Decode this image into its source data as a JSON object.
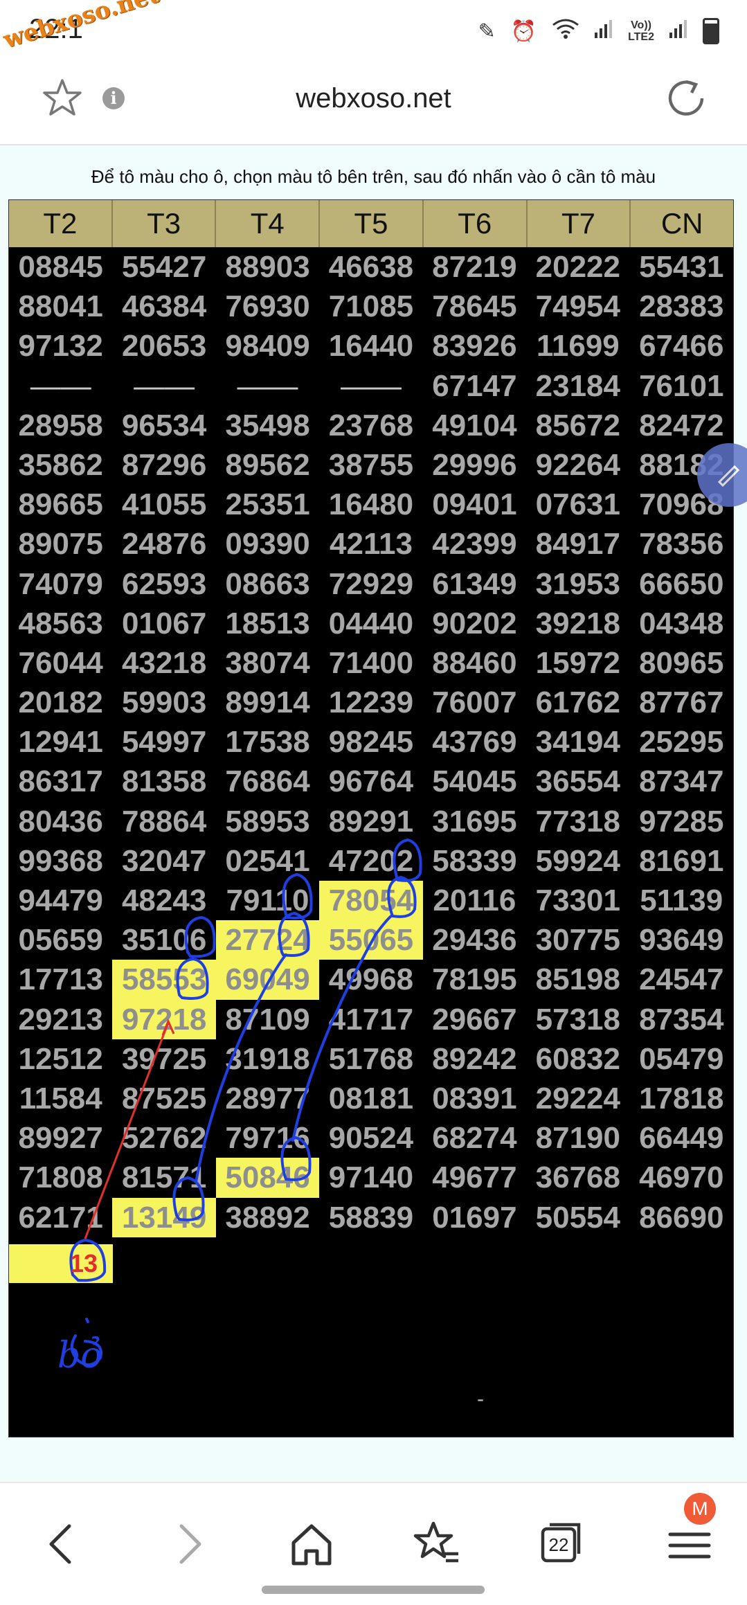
{
  "status": {
    "time": "22:1",
    "watermark": "webxoso.net",
    "network_label_line1": "Vo))",
    "network_label_line2": "LTE2"
  },
  "browser": {
    "url": "webxoso.net",
    "tabs_count": "22",
    "menu_badge": "M"
  },
  "page": {
    "instruction": "Để tô màu cho ô, chọn màu tô bên trên, sau đó nhấn vào ô cần tô màu",
    "headers": [
      "T2",
      "T3",
      "T4",
      "T5",
      "T6",
      "T7",
      "CN"
    ],
    "rows": [
      [
        "08845",
        "55427",
        "88903",
        "46638",
        "87219",
        "20222",
        "55431"
      ],
      [
        "88041",
        "46384",
        "76930",
        "71085",
        "78645",
        "74954",
        "28383"
      ],
      [
        "97132",
        "20653",
        "98409",
        "16440",
        "83926",
        "11699",
        "67466"
      ],
      [
        "——",
        "——",
        "——",
        "——",
        "67147",
        "23184",
        "76101"
      ],
      [
        "28958",
        "96534",
        "35498",
        "23768",
        "49104",
        "85672",
        "82472"
      ],
      [
        "35862",
        "87296",
        "89562",
        "38755",
        "29996",
        "92264",
        "88182"
      ],
      [
        "89665",
        "41055",
        "25351",
        "16480",
        "09401",
        "07631",
        "70968"
      ],
      [
        "89075",
        "24876",
        "09390",
        "42113",
        "42399",
        "84917",
        "78356"
      ],
      [
        "74079",
        "62593",
        "08663",
        "72929",
        "61349",
        "31953",
        "66650"
      ],
      [
        "48563",
        "01067",
        "18513",
        "04440",
        "90202",
        "39218",
        "04348"
      ],
      [
        "76044",
        "43218",
        "38074",
        "71400",
        "88460",
        "15972",
        "80965"
      ],
      [
        "20182",
        "59903",
        "89914",
        "12239",
        "76007",
        "61762",
        "87767"
      ],
      [
        "12941",
        "54997",
        "17538",
        "98245",
        "43769",
        "34194",
        "25295"
      ],
      [
        "86317",
        "81358",
        "76864",
        "96764",
        "54045",
        "36554",
        "87347"
      ],
      [
        "80436",
        "78864",
        "58953",
        "89291",
        "31695",
        "77318",
        "97285"
      ],
      [
        "99368",
        "32047",
        "02541",
        "47202",
        "58339",
        "59924",
        "81691"
      ],
      [
        "94479",
        "48243",
        "79110",
        "78054",
        "20116",
        "73301",
        "51139"
      ],
      [
        "05659",
        "35106",
        "27724",
        "55065",
        "29436",
        "30775",
        "93649"
      ],
      [
        "17713",
        "58553",
        "69049",
        "49968",
        "78195",
        "85198",
        "24547"
      ],
      [
        "29213",
        "97218",
        "87109",
        "41717",
        "29667",
        "57318",
        "87354"
      ],
      [
        "12512",
        "39725",
        "31918",
        "51768",
        "89242",
        "60832",
        "05479"
      ],
      [
        "11584",
        "87525",
        "28977",
        "08181",
        "08391",
        "29224",
        "17818"
      ],
      [
        "89927",
        "52762",
        "79716",
        "90524",
        "68274",
        "87190",
        "66449"
      ],
      [
        "71808",
        "81571",
        "50846",
        "97140",
        "49677",
        "36768",
        "46970"
      ],
      [
        "62171",
        "13149",
        "38892",
        "58839",
        "01697",
        "50554",
        "86690"
      ]
    ],
    "highlights": [
      [
        16,
        3
      ],
      [
        17,
        2
      ],
      [
        17,
        3
      ],
      [
        18,
        1
      ],
      [
        18,
        2
      ],
      [
        19,
        1
      ],
      [
        23,
        2
      ],
      [
        24,
        1
      ]
    ],
    "dash_rows": [
      3
    ],
    "annotation_number": "13",
    "annotation_word": "bỏ",
    "trailing_dash": "-"
  },
  "colors": {
    "header_bg": "#bcb277",
    "grid_bg": "#000000",
    "highlight": "#f6f560",
    "cell_text": "#a8a8a8",
    "page_bg": "#f1fcfd",
    "pen_blue": "#1f3fe0",
    "pen_red": "#e0302a",
    "badge": "#ee5b36"
  },
  "icons": {
    "favorite": "star-icon",
    "info": "info-icon",
    "reload": "reload-icon",
    "back": "chevron-left-icon",
    "forward": "chevron-right-icon",
    "home": "home-icon",
    "bookmarks": "star-list-icon",
    "tabs": "tabs-icon",
    "menu": "hamburger-icon",
    "float": "pen-icon"
  }
}
